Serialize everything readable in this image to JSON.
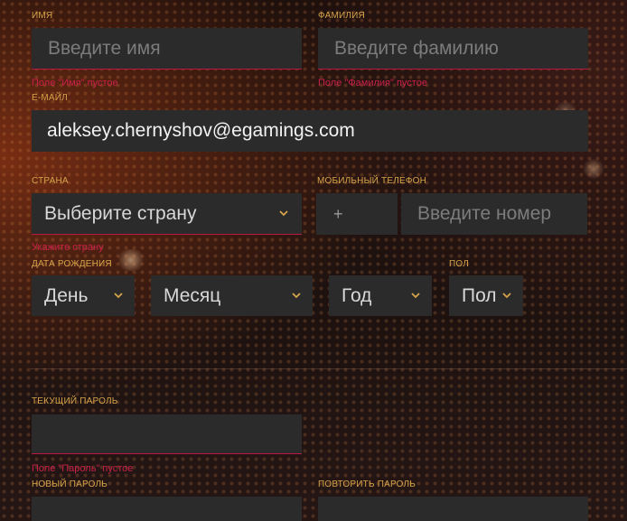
{
  "first_name": {
    "label": "Имя",
    "placeholder": "Введите имя",
    "error": "Поле \"Имя\" пустое"
  },
  "last_name": {
    "label": "Фамилия",
    "placeholder": "Введите фамилию",
    "error": "Поле \"Фамилия\" пустое"
  },
  "email": {
    "label": "E-майл",
    "value": "aleksey.chernyshov@egamings.com"
  },
  "country": {
    "label": "Страна",
    "value": "Выберите страну",
    "error": "Укажите страну"
  },
  "phone": {
    "label": "Мобильный телефон",
    "code": "+",
    "placeholder": "Введите номер"
  },
  "birth_date": {
    "label": "Дата рождения",
    "day": "День",
    "month": "Месяц",
    "year": "Год"
  },
  "gender": {
    "label": "Пол",
    "value": "Пол"
  },
  "current_password": {
    "label": "Текущий пароль",
    "error": "Поле \"Пароль\" пустое"
  },
  "new_password": {
    "label": "Новый пароль"
  },
  "repeat_password": {
    "label": "Повторить пароль"
  },
  "colors": {
    "accent": "#d6a44a",
    "error": "#c9204a",
    "field_bg": "#2b2b2b"
  },
  "icons": {
    "select_arrow": "chevron-down-icon"
  }
}
